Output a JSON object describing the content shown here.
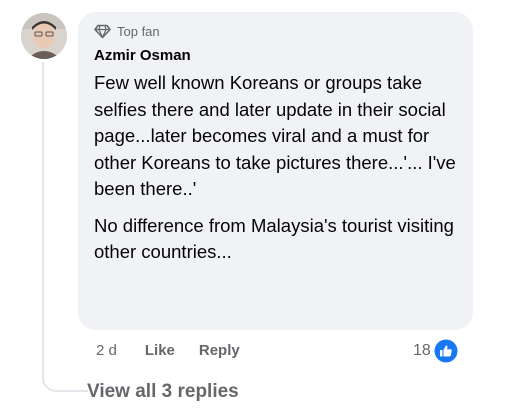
{
  "comment": {
    "badge": {
      "icon": "diamond-icon",
      "label": "Top fan"
    },
    "author": "Azmir Osman",
    "paragraphs": [
      "Few well known Koreans or groups take selfies there and later update in their social page...later becomes viral and a must for other Koreans to take pictures there...'... I've been there..'",
      "No difference from Malaysia's tourist visiting other countries..."
    ],
    "timestamp": "2 d",
    "like_label": "Like",
    "reply_label": "Reply",
    "reaction_count": "18",
    "reaction_icon": "like-thumb-icon",
    "colors": {
      "bubble": "#f0f2f5",
      "secondary_text": "#65676b",
      "like_blue": "#1877f2"
    }
  },
  "replies": {
    "view_label": "View all 3 replies"
  }
}
